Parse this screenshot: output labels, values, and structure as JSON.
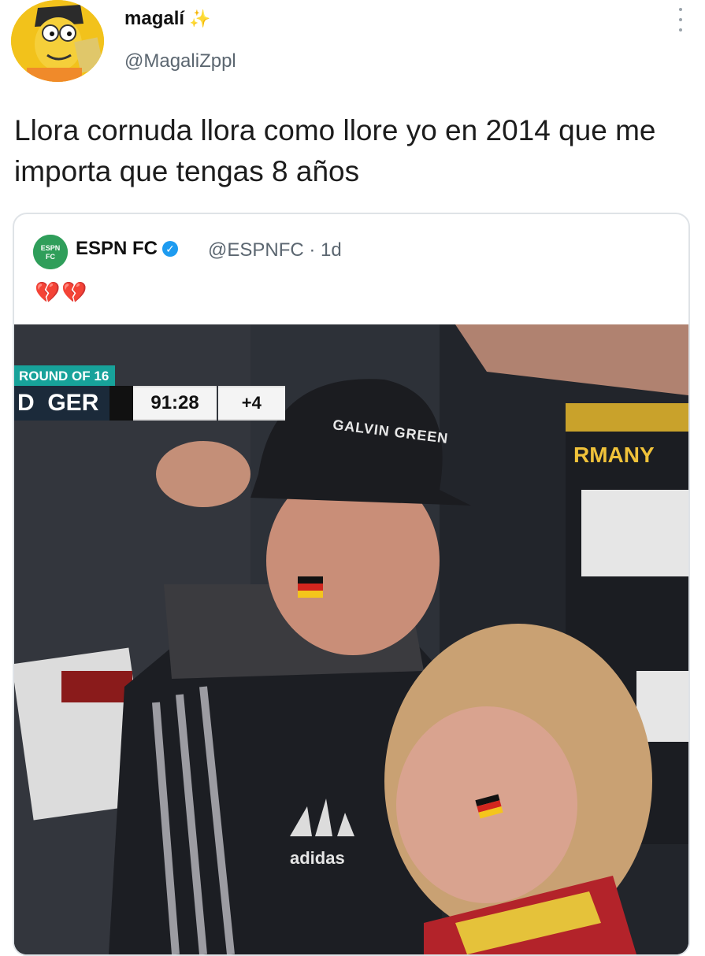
{
  "tweet": {
    "display_name": "magalí",
    "name_emoji": "✨",
    "handle": "@MagaliZppl",
    "text": "Llora cornuda llora como llore yo en 2014 que me importa que tengas 8 años",
    "more_icon": "vertical-ellipsis-icon"
  },
  "quoted_tweet": {
    "name": "ESPN FC",
    "verified_icon": "verified-badge-icon",
    "handle": "@ESPNFC · 1d",
    "text": "💔💔",
    "media": {
      "score_round": "ROUND OF 16",
      "score_team": "GER",
      "score_team_prefix": "D",
      "score_clock": "91:28",
      "score_added": "+4",
      "cap_text": "GALVIN GREEN",
      "scarf_text": "RMANY",
      "brand_text": "adidas"
    }
  },
  "colors": {
    "accent": "#1d9bf0",
    "score_teal": "#17a29a",
    "espn_green": "#2f9e5a"
  }
}
